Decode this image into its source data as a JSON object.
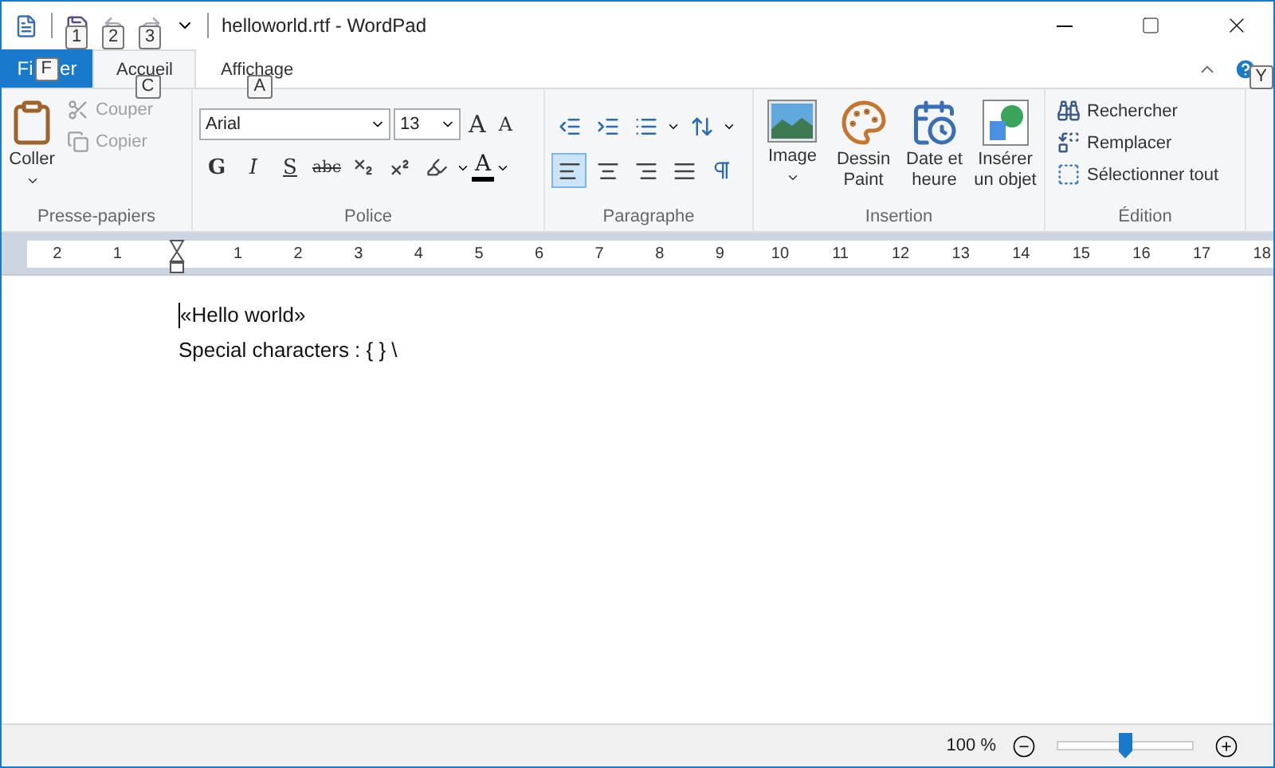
{
  "window": {
    "title": "helloworld.rtf - WordPad"
  },
  "quick_access": {
    "keytips": [
      "1",
      "2",
      "3"
    ],
    "redo_disabled": true
  },
  "tabs": [
    {
      "kind": "file",
      "label_parts": [
        "Fi",
        "er"
      ],
      "keytip": "F",
      "selected": false
    },
    {
      "kind": "tab",
      "label": "Accueil",
      "keytip": "C",
      "selected": true
    },
    {
      "kind": "tab",
      "label": "Affichage",
      "keytip": "A",
      "selected": false
    }
  ],
  "help_keytip": "Y",
  "clipboard": {
    "title": "Presse-papiers",
    "paste": "Coller",
    "items": [
      {
        "kind": "cut",
        "label": "Couper",
        "disabled": true
      },
      {
        "kind": "copy",
        "label": "Copier",
        "disabled": true
      }
    ]
  },
  "font": {
    "title": "Police",
    "family": "Arial",
    "size": "13",
    "grow": "A",
    "shrink": "A",
    "styles": [
      {
        "kind": "bold",
        "label": "G"
      },
      {
        "kind": "italic",
        "label": "I"
      },
      {
        "kind": "underline",
        "label": "S"
      },
      {
        "kind": "strike",
        "label": "abc"
      }
    ],
    "color_label": "A"
  },
  "paragraph": {
    "title": "Paragraphe",
    "alignments": [
      {
        "kind": "left",
        "selected": true
      },
      {
        "kind": "center",
        "selected": false
      },
      {
        "kind": "right",
        "selected": false
      },
      {
        "kind": "justify",
        "selected": false
      }
    ]
  },
  "insertion": {
    "title": "Insertion",
    "items": [
      {
        "kind": "image",
        "label": "Image",
        "dropdown": true
      },
      {
        "kind": "paint",
        "label": "Dessin Paint",
        "dropdown": false
      },
      {
        "kind": "datetime",
        "label": "Date et heure",
        "dropdown": false
      },
      {
        "kind": "object",
        "label": "Insérer un objet",
        "dropdown": false
      }
    ]
  },
  "editing": {
    "title": "Édition",
    "items": [
      {
        "kind": "find",
        "label": "Rechercher"
      },
      {
        "kind": "replace",
        "label": "Remplacer"
      },
      {
        "kind": "selectall",
        "label": "Sélectionner tout"
      }
    ]
  },
  "ruler": {
    "left_labels": [
      "2",
      "1"
    ],
    "right_labels": [
      "1",
      "2",
      "3",
      "4",
      "5",
      "6",
      "7",
      "8",
      "9",
      "10",
      "11",
      "12",
      "13",
      "14",
      "15",
      "16",
      "17",
      "18"
    ]
  },
  "document": {
    "lines": [
      "«Hello world»",
      "Special characters : { } \\"
    ]
  },
  "status_bar": {
    "zoom": "100 %",
    "level": 0.5
  }
}
